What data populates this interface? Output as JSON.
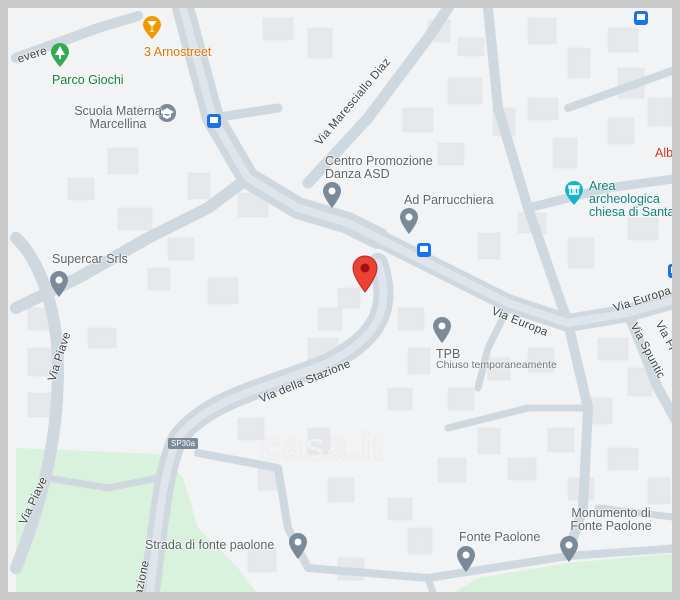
{
  "map": {
    "colors": {
      "land": "#f1f3f4",
      "road": "#cfd8de",
      "park": "#d8f2dd",
      "building": "#e8eaed",
      "marker": "#ea4335",
      "frame": "#c9c9c9"
    },
    "selected_marker": "red-location-pin",
    "watermark": "casa.it",
    "places": [
      {
        "name": "3 Arnostreet",
        "icon": "bar-icon"
      },
      {
        "name": "Parco Giochi",
        "icon": "park-tree-icon"
      },
      {
        "name": "Scuola Materna Marcellina",
        "icon": "school-icon"
      },
      {
        "name": "Centro Promozione Danza ASD",
        "icon": "pin-icon"
      },
      {
        "name": "Ad Parrucchiera",
        "icon": "pin-icon"
      },
      {
        "name": "Area archeologica chiesa di Santa",
        "icon": "archaeology-icon"
      },
      {
        "name": "Albe",
        "icon": "none"
      },
      {
        "name": "Supercar Srls",
        "icon": "pin-icon"
      },
      {
        "name": "TPB",
        "subtitle": "Chiuso temporaneamente",
        "icon": "pin-icon"
      },
      {
        "name": "Strada di fonte paolone",
        "icon": "pin-icon"
      },
      {
        "name": "Fonte Paolone",
        "icon": "pin-icon"
      },
      {
        "name": "Monumento di Fonte Paolone",
        "icon": "pin-icon"
      }
    ],
    "streets": [
      "Via Maresciallo Diaz",
      "Via Europa",
      "Via Europa",
      "Via della Stazione",
      "Via Piave",
      "Via Piave",
      "Via Spuntice",
      "Via Fi",
      "evere",
      "tazione"
    ],
    "shield": "SP30a",
    "bus_stops": 4
  }
}
